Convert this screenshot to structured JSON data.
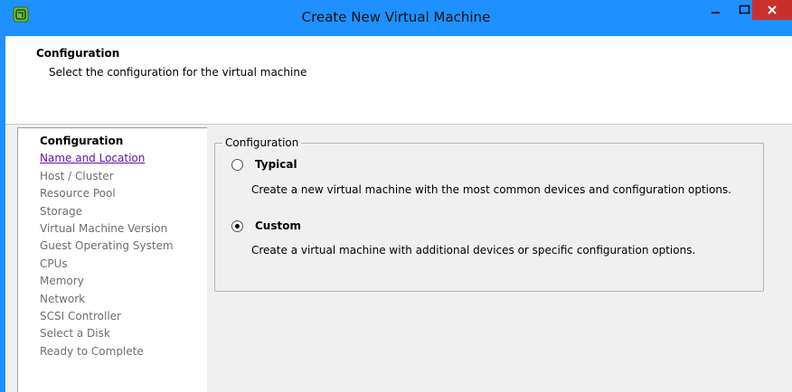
{
  "window": {
    "title": "Create New Virtual Machine",
    "minimize_glyph": "–",
    "maximize_glyph": "□",
    "close_glyph": "✕",
    "accent_color": "#1e90ff",
    "close_color": "#c9302c"
  },
  "header": {
    "title": "Configuration",
    "subtitle": "Select the configuration for the virtual machine"
  },
  "nav": {
    "items": [
      {
        "label": "Configuration",
        "state": "active"
      },
      {
        "label": "Name and Location",
        "state": "link"
      },
      {
        "label": "Host / Cluster",
        "state": "disabled"
      },
      {
        "label": "Resource Pool",
        "state": "disabled"
      },
      {
        "label": "Storage",
        "state": "disabled"
      },
      {
        "label": "Virtual Machine Version",
        "state": "disabled"
      },
      {
        "label": "Guest Operating System",
        "state": "disabled"
      },
      {
        "label": "CPUs",
        "state": "disabled"
      },
      {
        "label": "Memory",
        "state": "disabled"
      },
      {
        "label": "Network",
        "state": "disabled"
      },
      {
        "label": "SCSI Controller",
        "state": "disabled"
      },
      {
        "label": "Select a Disk",
        "state": "disabled"
      },
      {
        "label": "Ready to Complete",
        "state": "disabled"
      }
    ]
  },
  "config_group": {
    "legend": "Configuration",
    "options": [
      {
        "label": "Typical",
        "description": "Create a new virtual machine with the most common devices and configuration options.",
        "checked": false
      },
      {
        "label": "Custom",
        "description": "Create a virtual machine with additional devices or specific configuration options.",
        "checked": true
      }
    ]
  }
}
